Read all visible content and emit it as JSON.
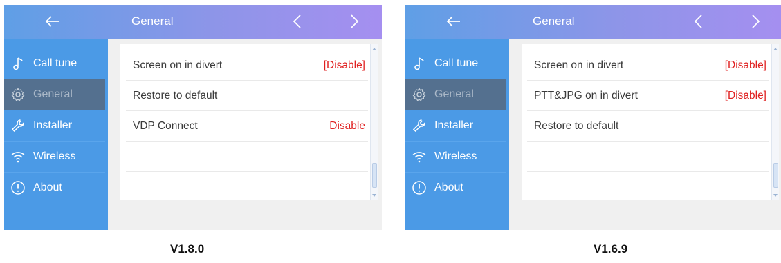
{
  "screens": [
    {
      "header": {
        "title": "General"
      },
      "sidebar": {
        "items": [
          {
            "label": "Call tune",
            "icon": "music-note-icon"
          },
          {
            "label": "General",
            "icon": "gear-icon"
          },
          {
            "label": "Installer",
            "icon": "wrench-icon"
          },
          {
            "label": "Wireless",
            "icon": "wifi-icon"
          },
          {
            "label": "About",
            "icon": "info-icon"
          }
        ]
      },
      "settings": [
        {
          "label": "Screen on in divert",
          "value": "[Disable]"
        },
        {
          "label": "Restore to default",
          "value": ""
        },
        {
          "label": "VDP Connect",
          "value": "Disable"
        }
      ],
      "version": "V1.8.0"
    },
    {
      "header": {
        "title": "General"
      },
      "sidebar": {
        "items": [
          {
            "label": "Call tune",
            "icon": "music-note-icon"
          },
          {
            "label": "General",
            "icon": "gear-icon"
          },
          {
            "label": "Installer",
            "icon": "wrench-icon"
          },
          {
            "label": "Wireless",
            "icon": "wifi-icon"
          },
          {
            "label": "About",
            "icon": "info-icon"
          }
        ]
      },
      "settings": [
        {
          "label": "Screen on in divert",
          "value": "[Disable]"
        },
        {
          "label": "PTT&JPG on in divert",
          "value": "[Disable]"
        },
        {
          "label": "Restore to default",
          "value": ""
        }
      ],
      "version": "V1.6.9"
    }
  ],
  "colors": {
    "sidebar": "#4b9ae6",
    "sidebar_active": "#54708f",
    "value_red": "#e02020",
    "header_start": "#5f9fe6",
    "header_end": "#a58ff0"
  }
}
